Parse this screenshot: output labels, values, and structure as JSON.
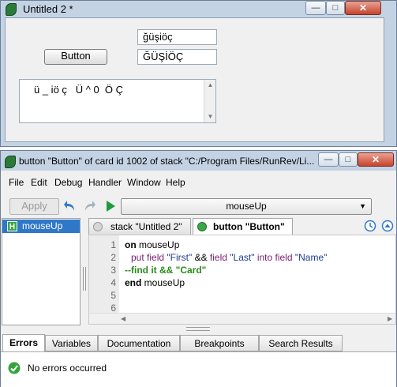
{
  "window1": {
    "title": "Untitled 2 *",
    "first_field": "ğüşiöç",
    "last_field": "ĞÜŞİÖÇ",
    "button_label": "Button",
    "name_field": "ü _ iö ç   Ü ^ 0  Ö Ç",
    "min_glyph": "—",
    "max_glyph": "□",
    "close_glyph": "✕"
  },
  "window2": {
    "title": "button \"Button\" of card id 1002 of stack \"C:/Program Files/RunRev/Li...",
    "min_glyph": "—",
    "max_glyph": "□",
    "close_glyph": "✕",
    "menu": [
      "File",
      "Edit",
      "Debug",
      "Handler",
      "Window",
      "Help"
    ],
    "apply_label": "Apply",
    "dropdown_value": "mouseUp",
    "handler_list": [
      {
        "badge": "H",
        "label": "mouseUp"
      }
    ],
    "tabs": [
      "stack \"Untitled 2\"",
      "button \"Button\""
    ],
    "line_numbers": [
      "1",
      "2",
      "3",
      "4",
      "5",
      "6"
    ],
    "code": {
      "l1_kw": "on",
      "l1_rest": " mouseUp",
      "l2_put": "put",
      "l2_field1": " field ",
      "l2_first": "\"First\"",
      "l2_amp": " && ",
      "l2_field2": "field ",
      "l2_last": "\"Last\"",
      "l2_into": " into ",
      "l2_field3": "field ",
      "l2_name": "\"Name\"",
      "l3_comment": "--find it && \"Card\"",
      "l4_kw": "end",
      "l4_rest": " mouseUp"
    },
    "bottom_tabs": [
      "Errors",
      "Variables",
      "Documentation",
      "Breakpoints",
      "Search Results"
    ],
    "status_text": "No errors occurred"
  },
  "colors": {
    "title_bg": "#c4d3e4",
    "accent_blue": "#2f78c8",
    "success_green": "#35a23a"
  }
}
